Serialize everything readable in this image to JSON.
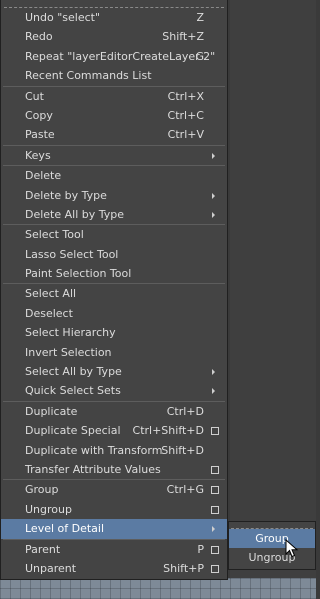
{
  "menu": {
    "groups": [
      [
        {
          "label": "Undo \"select\"",
          "shortcut": "Z"
        },
        {
          "label": "Redo",
          "shortcut": "Shift+Z"
        },
        {
          "label": "Repeat \"layerEditorCreateLayer 2\"",
          "shortcut": "G"
        },
        {
          "label": "Recent Commands List",
          "shortcut": ""
        }
      ],
      [
        {
          "label": "Cut",
          "shortcut": "Ctrl+X"
        },
        {
          "label": "Copy",
          "shortcut": "Ctrl+C"
        },
        {
          "label": "Paste",
          "shortcut": "Ctrl+V"
        }
      ],
      [
        {
          "label": "Keys",
          "shortcut": "",
          "submenu": true
        }
      ],
      [
        {
          "label": "Delete",
          "shortcut": ""
        },
        {
          "label": "Delete by Type",
          "shortcut": "",
          "submenu": true
        },
        {
          "label": "Delete All by Type",
          "shortcut": "",
          "submenu": true
        }
      ],
      [
        {
          "label": "Select Tool",
          "shortcut": ""
        },
        {
          "label": "Lasso Select Tool",
          "shortcut": ""
        },
        {
          "label": "Paint Selection Tool",
          "shortcut": ""
        }
      ],
      [
        {
          "label": "Select All",
          "shortcut": ""
        },
        {
          "label": "Deselect",
          "shortcut": ""
        },
        {
          "label": "Select Hierarchy",
          "shortcut": ""
        },
        {
          "label": "Invert Selection",
          "shortcut": ""
        },
        {
          "label": "Select All by Type",
          "shortcut": "",
          "submenu": true
        },
        {
          "label": "Quick Select Sets",
          "shortcut": "",
          "submenu": true
        }
      ],
      [
        {
          "label": "Duplicate",
          "shortcut": "Ctrl+D"
        },
        {
          "label": "Duplicate Special",
          "shortcut": "Ctrl+Shift+D",
          "option_box": true
        },
        {
          "label": "Duplicate with Transform",
          "shortcut": "Shift+D"
        },
        {
          "label": "Transfer Attribute Values",
          "shortcut": "",
          "option_box": true
        }
      ],
      [
        {
          "label": "Group",
          "shortcut": "Ctrl+G",
          "option_box": true
        },
        {
          "label": "Ungroup",
          "shortcut": "",
          "option_box": true
        },
        {
          "label": "Level of Detail",
          "shortcut": "",
          "submenu": true,
          "highlighted": true
        }
      ],
      [
        {
          "label": "Parent",
          "shortcut": "P",
          "option_box": true
        },
        {
          "label": "Unparent",
          "shortcut": "Shift+P",
          "option_box": true
        }
      ]
    ]
  },
  "submenu": {
    "items": [
      {
        "label": "Group",
        "highlighted": true
      },
      {
        "label": "Ungroup",
        "highlighted": false
      }
    ]
  },
  "colors": {
    "menu_bg": "#444444",
    "highlight": "#5b7ba3",
    "text": "#dcdcdc"
  }
}
